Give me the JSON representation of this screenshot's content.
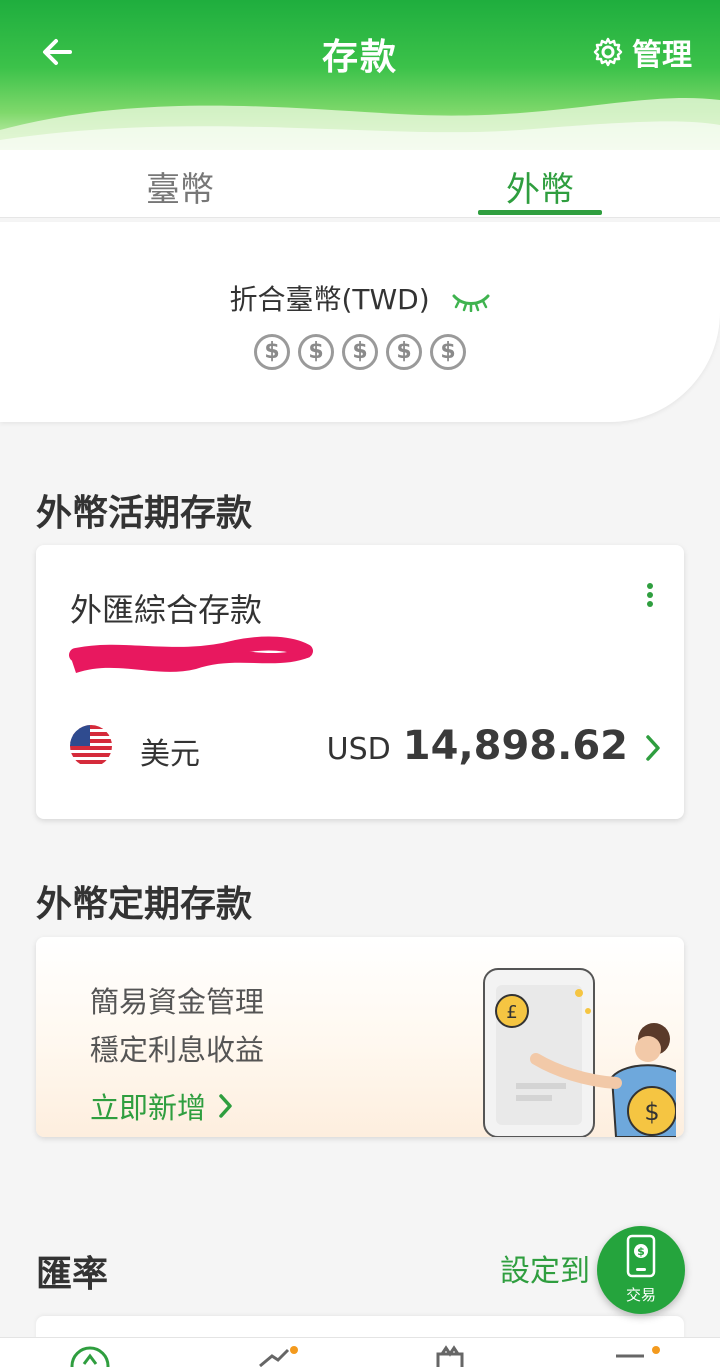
{
  "header": {
    "title": "存款",
    "manage_label": "管理"
  },
  "tabs": [
    {
      "label": "臺幣",
      "active": false
    },
    {
      "label": "外幣",
      "active": true
    }
  ],
  "summary": {
    "label": "折合臺幣(TWD)",
    "masked_coins": [
      "$",
      "$",
      "$",
      "$",
      "$"
    ]
  },
  "demand": {
    "section_title": "外幣活期存款",
    "account_name": "外匯綜合存款",
    "currency_name": "美元",
    "currency_code": "USD",
    "balance": "14,898.62"
  },
  "time_deposit": {
    "section_title": "外幣定期存款",
    "line1": "簡易資金管理",
    "line2": "穩定利息收益",
    "link": "立即新增"
  },
  "rate": {
    "title": "匯率",
    "setting": "設定到"
  },
  "fab": {
    "label": "交易"
  },
  "colors": {
    "brand_green": "#2f9e3f",
    "header_green": "#1fae3e",
    "notification": "#f39a1e"
  }
}
